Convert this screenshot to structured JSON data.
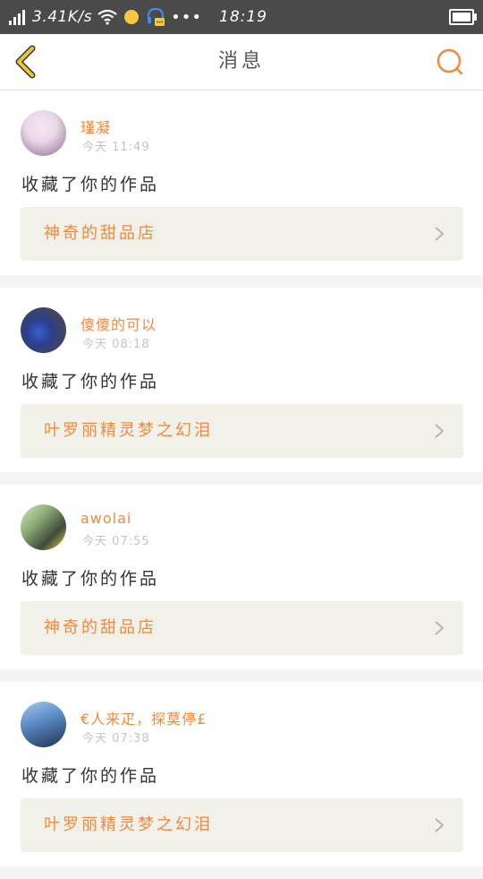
{
  "status_bar": {
    "network_speed": "3.41K/s",
    "time": "18:19",
    "more": "•••"
  },
  "header": {
    "title": "消息"
  },
  "messages": [
    {
      "username": "瑾凝",
      "timestamp": "今天 11:49",
      "action": "收藏了你的作品",
      "work_title": "神奇的甜品店",
      "avatar_colors": [
        "#e9d7e8",
        "#8a6a86"
      ]
    },
    {
      "username": "傻傻的可以",
      "timestamp": "今天 08:18",
      "action": "收藏了你的作品",
      "work_title": "叶罗丽精灵梦之幻泪",
      "avatar_colors": [
        "#3a5fd0",
        "#5a4a36"
      ]
    },
    {
      "username": "awolai",
      "timestamp": "今天 07:55",
      "action": "收藏了你的作品",
      "work_title": "神奇的甜品店",
      "avatar_colors": [
        "#d6e6c2",
        "#3f4a3a"
      ]
    },
    {
      "username": "€人来疋，探莫停£",
      "timestamp": "今天 07:38",
      "action": "收藏了你的作品",
      "work_title": "叶罗丽精灵梦之幻泪",
      "avatar_colors": [
        "#5f8ec9",
        "#1f3350"
      ]
    }
  ],
  "colors": {
    "accent": "#f08a3c",
    "back_arrow": "#e6c73a",
    "status_bar_bg": "#4a4a4a",
    "link_bg": "#f1f1ea"
  }
}
